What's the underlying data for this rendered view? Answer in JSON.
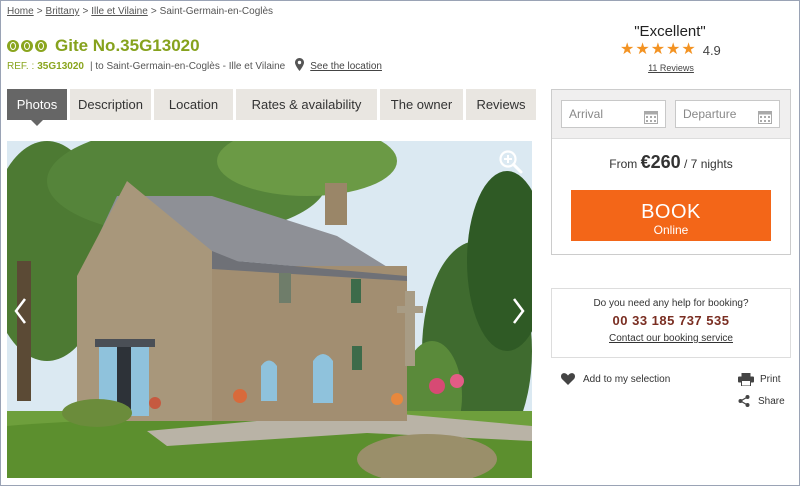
{
  "breadcrumb": {
    "items": [
      "Home",
      "Brittany",
      "Ille et Vilaine"
    ],
    "current": "Saint-Germain-en-Coglès",
    "separator": ">"
  },
  "listing": {
    "title": "Gite No.35G13020",
    "ref_label": "REF. :",
    "ref_code": "35G13020",
    "location": "| to Saint-Germain-en-Coglès - Ille et Vilaine",
    "see_location": "See the location"
  },
  "rating": {
    "word": "\"Excellent\"",
    "score": "4.9",
    "stars": 5,
    "reviews": "11 Reviews"
  },
  "tabs": [
    {
      "label": "Photos",
      "active": true
    },
    {
      "label": "Description",
      "active": false
    },
    {
      "label": "Location",
      "active": false
    },
    {
      "label": "Rates & availability",
      "active": false
    },
    {
      "label": "The owner",
      "active": false
    },
    {
      "label": "Reviews",
      "active": false
    }
  ],
  "booking": {
    "arrival_placeholder": "Arrival",
    "departure_placeholder": "Departure",
    "from_label": "From",
    "price": "€260",
    "per": "/ 7 nights",
    "book_label": "BOOK",
    "book_sub": "Online"
  },
  "help": {
    "question": "Do you need any help for booking?",
    "phone": "00 33 185 737 535",
    "contact": "Contact our booking service"
  },
  "actions": {
    "add_selection": "Add to my selection",
    "print": "Print",
    "share": "Share"
  },
  "colors": {
    "green": "#86a21d",
    "orange_button": "#f36618",
    "star": "#f39323",
    "tab_active": "#666666",
    "tab_inactive": "#e9e6e1",
    "phone": "#7a2e22"
  }
}
